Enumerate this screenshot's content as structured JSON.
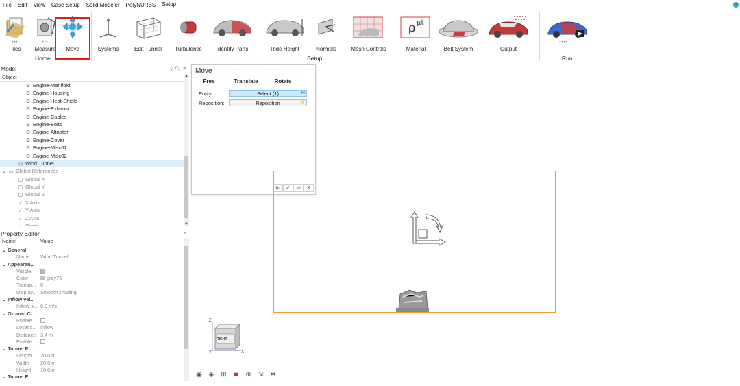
{
  "menu": [
    "File",
    "Edit",
    "View",
    "Case Setup",
    "Solid Modeler",
    "PolyNURBS",
    "Setup"
  ],
  "ribbon": {
    "tools": [
      {
        "label": "Files",
        "icon": "files-icon"
      },
      {
        "label": "Measure",
        "icon": "measure-icon"
      },
      {
        "label": "Move",
        "icon": "move-icon"
      },
      {
        "label": "Systems",
        "icon": "systems-icon"
      },
      {
        "label": "Edit Tunnel",
        "icon": "edit-tunnel-icon"
      },
      {
        "label": "Turbulence",
        "icon": "turbulence-icon"
      },
      {
        "label": "Identify Parts",
        "icon": "identify-parts-icon"
      },
      {
        "label": "Ride Height",
        "icon": "ride-height-icon"
      },
      {
        "label": "Normals",
        "icon": "normals-icon"
      },
      {
        "label": "Mesh Controls",
        "icon": "mesh-controls-icon"
      },
      {
        "label": "Material",
        "icon": "material-icon"
      },
      {
        "label": "Belt System",
        "icon": "belt-system-icon"
      },
      {
        "label": "Output",
        "icon": "output-icon"
      },
      {
        "label": "Run",
        "icon": "run-icon"
      }
    ],
    "groups": {
      "home": "Home",
      "setup": "Setup",
      "run": "Run"
    }
  },
  "model": {
    "title": "Model",
    "column": "Object",
    "items": [
      {
        "label": "Engine-Manifold",
        "indent": 3
      },
      {
        "label": "Engine-Housing",
        "indent": 3
      },
      {
        "label": "Engine-Heat-Shield",
        "indent": 3
      },
      {
        "label": "Engine-Exhaust",
        "indent": 3
      },
      {
        "label": "Engine-Cables",
        "indent": 3
      },
      {
        "label": "Engine-Bolts",
        "indent": 3
      },
      {
        "label": "Engine-Altnator",
        "indent": 3
      },
      {
        "label": "Engine-Cover",
        "indent": 3
      },
      {
        "label": "Engine-Misc01",
        "indent": 3
      },
      {
        "label": "Engine-Misc02",
        "indent": 3
      },
      {
        "label": "Wind Tunnel",
        "indent": 2
      },
      {
        "label": "Global References",
        "indent": 0
      },
      {
        "label": "Global X",
        "indent": 2
      },
      {
        "label": "Global Y",
        "indent": 2
      },
      {
        "label": "Global Z",
        "indent": 2
      },
      {
        "label": "X Axis",
        "indent": 2
      },
      {
        "label": "Y Axis",
        "indent": 2
      },
      {
        "label": "Z Axis",
        "indent": 2
      },
      {
        "label": "Origin",
        "indent": 2
      }
    ]
  },
  "property_editor": {
    "title": "Property Editor",
    "col_name": "Name",
    "col_value": "Value",
    "rows": [
      {
        "name": "General",
        "value": "",
        "group": true
      },
      {
        "name": "Name",
        "value": "Wind Tunnel"
      },
      {
        "name": "Appearan...",
        "value": "",
        "group": true
      },
      {
        "name": "Visible",
        "value": ""
      },
      {
        "name": "Color",
        "value": "gray75"
      },
      {
        "name": "Transp...",
        "value": "0"
      },
      {
        "name": "Display...",
        "value": "Smooth shading"
      },
      {
        "name": "Inflow vel...",
        "value": "",
        "group": true
      },
      {
        "name": "Inflow s...",
        "value": "0.0 m/s"
      },
      {
        "name": "Ground C...",
        "value": "",
        "group": true
      },
      {
        "name": "Enable ...",
        "value": ""
      },
      {
        "name": "Locatio...",
        "value": "Inflow"
      },
      {
        "name": "Distance",
        "value": "3.4 m"
      },
      {
        "name": "Enable ...",
        "value": ""
      },
      {
        "name": "Tunnel Pr...",
        "value": "",
        "group": true
      },
      {
        "name": "Length",
        "value": "20.0 m"
      },
      {
        "name": "Width",
        "value": "20.0 m"
      },
      {
        "name": "Height",
        "value": "10.0 m"
      },
      {
        "name": "Tunnel E...",
        "value": "",
        "group": true
      }
    ]
  },
  "move_dialog": {
    "title": "Move",
    "tabs": [
      "Free",
      "Translate",
      "Rotate"
    ],
    "entity_label": "Entity:",
    "entity_value": "Select (1)",
    "reposition_label": "Reposition:",
    "reposition_value": "Reposition"
  },
  "view_cube": {
    "face": "RIGHT",
    "axis_z": "Z",
    "axis_y": "Y",
    "axis_x": "X"
  }
}
